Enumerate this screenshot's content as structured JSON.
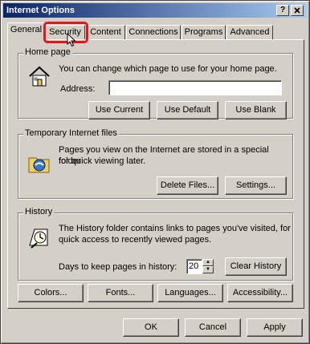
{
  "window": {
    "title": "Internet Options",
    "help_label": "?",
    "close_label": "X"
  },
  "tabs": [
    {
      "label": "General",
      "active": true
    },
    {
      "label": "Security",
      "active": false
    },
    {
      "label": "Content",
      "active": false
    },
    {
      "label": "Connections",
      "active": false
    },
    {
      "label": "Programs",
      "active": false
    },
    {
      "label": "Advanced",
      "active": false
    }
  ],
  "home_page": {
    "title": "Home page",
    "description": "You can change which page to use for your home page.",
    "address_label": "Address:",
    "address_value": "",
    "use_current": "Use Current",
    "use_default": "Use Default",
    "use_blank": "Use Blank"
  },
  "temp_files": {
    "title": "Temporary Internet files",
    "description_line1": "Pages you view on the Internet are stored in a special folder",
    "description_line2": "for quick viewing later.",
    "delete_files": "Delete Files...",
    "settings": "Settings..."
  },
  "history": {
    "title": "History",
    "description_line1": "The History folder contains links to pages you've visited, for",
    "description_line2": "quick access to recently viewed pages.",
    "days_label": "Days to keep pages in history:",
    "days_value": "20",
    "clear_history": "Clear History"
  },
  "bottom_buttons": {
    "colors": "Colors...",
    "fonts": "Fonts...",
    "languages": "Languages...",
    "accessibility": "Accessibility..."
  },
  "dialog_buttons": {
    "ok": "OK",
    "cancel": "Cancel",
    "apply": "Apply"
  },
  "colors": {
    "title_start": "#0a246a",
    "title_end": "#a6caf0",
    "face": "#d4d0c8",
    "highlight": "#e8141c"
  }
}
